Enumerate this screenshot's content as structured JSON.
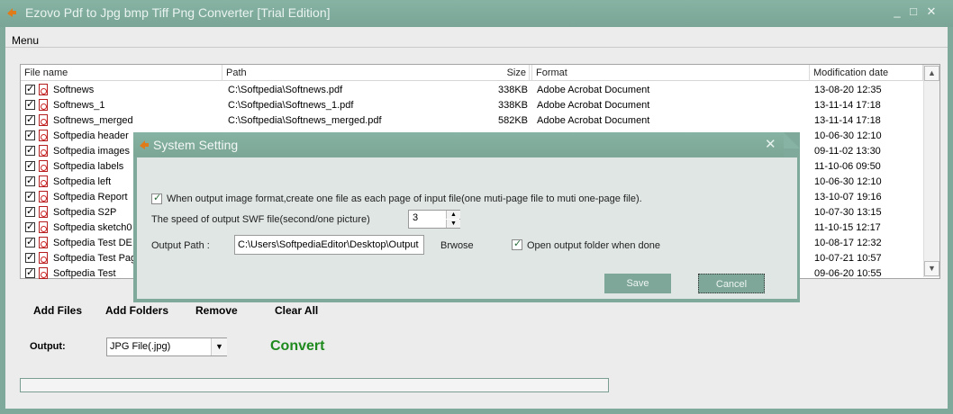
{
  "window": {
    "title": "Ezovo Pdf to Jpg bmp Tiff Png Converter [Trial Edition]",
    "controls": [
      "_",
      "□",
      "✕"
    ]
  },
  "menu": {
    "items": [
      "Menu"
    ]
  },
  "table": {
    "headers": [
      "File name",
      "Path",
      "Size",
      "Format",
      "Modification date"
    ],
    "rows": [
      {
        "name": "Softnews",
        "path": "C:\\Softpedia\\Softnews.pdf",
        "size": "338KB",
        "format": "Adobe Acrobat Document",
        "date": "13-08-20 12:35"
      },
      {
        "name": "Softnews_1",
        "path": "C:\\Softpedia\\Softnews_1.pdf",
        "size": "338KB",
        "format": "Adobe Acrobat Document",
        "date": "13-11-14 17:18"
      },
      {
        "name": "Softnews_merged",
        "path": "C:\\Softpedia\\Softnews_merged.pdf",
        "size": "582KB",
        "format": "Adobe Acrobat Document",
        "date": "13-11-14 17:18"
      },
      {
        "name": "Softpedia header",
        "path": "",
        "size": "",
        "format": "",
        "date": "10-06-30 12:10"
      },
      {
        "name": "Softpedia images",
        "path": "",
        "size": "",
        "format": "",
        "date": "09-11-02 13:30"
      },
      {
        "name": "Softpedia labels",
        "path": "",
        "size": "",
        "format": "",
        "date": "11-10-06 09:50"
      },
      {
        "name": "Softpedia left",
        "path": "",
        "size": "",
        "format": "",
        "date": "10-06-30 12:10"
      },
      {
        "name": "Softpedia Report",
        "path": "",
        "size": "",
        "format": "",
        "date": "13-10-07 19:16"
      },
      {
        "name": "Softpedia S2P",
        "path": "",
        "size": "",
        "format": "",
        "date": "10-07-30 13:15"
      },
      {
        "name": "Softpedia sketch0",
        "path": "",
        "size": "",
        "format": "",
        "date": "11-10-15 12:17"
      },
      {
        "name": "Softpedia Test DE",
        "path": "",
        "size": "",
        "format": "",
        "date": "10-08-17 12:32"
      },
      {
        "name": "Softpedia Test Pag",
        "path": "",
        "size": "",
        "format": "",
        "date": "10-07-21 10:57"
      },
      {
        "name": "Softpedia Test",
        "path": "",
        "size": "",
        "format": "",
        "date": "09-06-20 10:55"
      }
    ]
  },
  "actions": {
    "add_files": "Add Files",
    "add_folders": "Add Folders",
    "remove": "Remove",
    "clear_all": "Clear All"
  },
  "output": {
    "label": "Output:",
    "selected": "JPG File(.jpg)",
    "convert": "Convert"
  },
  "progress": {
    "value": 0
  },
  "dialog": {
    "title": "System Setting",
    "option_one_file": "When output image format,create one file as each page of input file(one muti-page file to muti one-page file).",
    "option_one_file_checked": true,
    "speed_label": "The speed of output SWF file(second/one picture)",
    "speed_value": "3",
    "output_path_label": "Output Path :",
    "output_path_value": "C:\\Users\\SoftpediaEditor\\Desktop\\Output",
    "browse": "Brwose",
    "open_folder_label": "Open output folder when done",
    "open_folder_checked": true,
    "save": "Save",
    "cancel": "Cancel"
  }
}
